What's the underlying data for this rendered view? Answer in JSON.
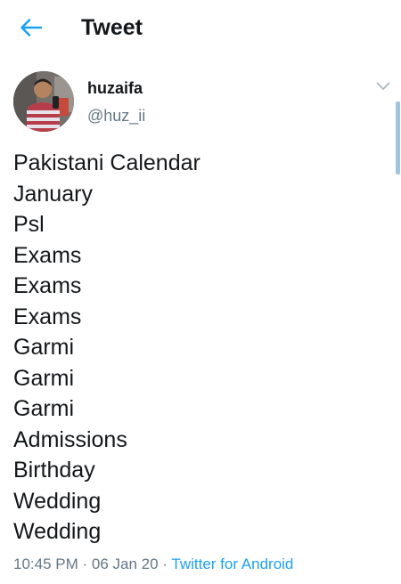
{
  "header": {
    "title": "Tweet",
    "back_icon": "arrow-left-icon",
    "accent_color": "#1da1f2"
  },
  "author": {
    "display_name": "huzaifa",
    "handle": "@huz_ii",
    "menu_icon": "chevron-down-icon"
  },
  "tweet": {
    "lines": [
      "Pakistani Calendar",
      "January",
      "Psl",
      "Exams",
      "Exams",
      "Exams",
      "Garmi",
      "Garmi",
      "Garmi",
      "Admissions",
      "Birthday",
      "Wedding",
      "Wedding"
    ],
    "time": "10:45 PM",
    "date": "06 Jan 20",
    "separator": " · ",
    "source": "Twitter for Android"
  }
}
